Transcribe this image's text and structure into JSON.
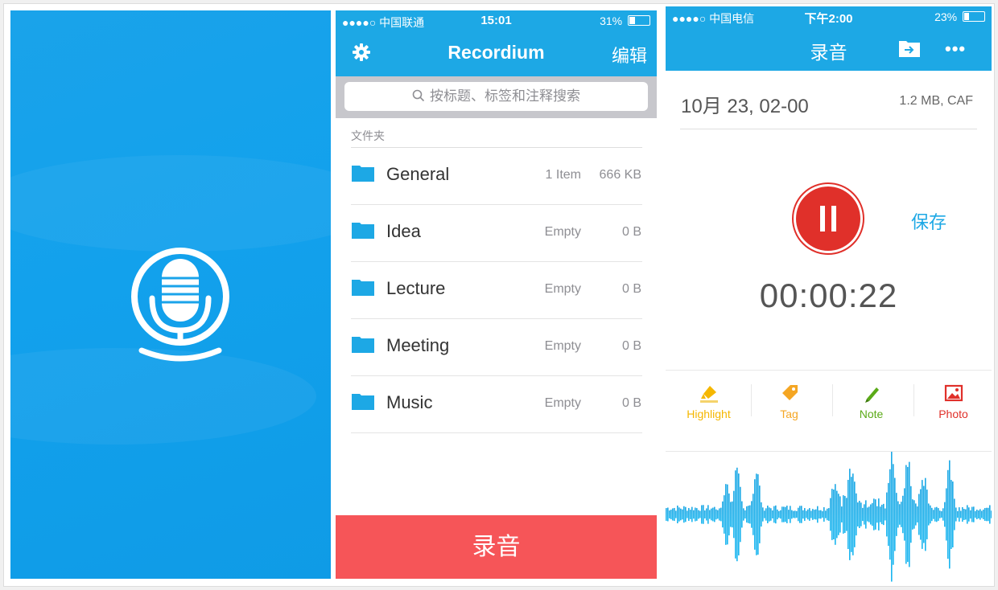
{
  "colors": {
    "brand_blue": "#1da8e5",
    "record_red": "#f65558",
    "highlight": "#f5b700",
    "tag": "#f5a623",
    "note": "#5aaa17",
    "photo": "#e0302a"
  },
  "splash": {
    "logo_icon": "microphone-icon"
  },
  "folders_screen": {
    "status": {
      "carrier": "●●●●○ 中国联通",
      "time": "15:01",
      "battery": "31%",
      "battery_level": 0.31
    },
    "title": "Recordium",
    "edit_label": "编辑",
    "search_placeholder": "按标题、标签和注释搜索",
    "section_label": "文件夹",
    "folders": [
      {
        "name": "General",
        "count": "1 Item",
        "size": "666 KB"
      },
      {
        "name": "Idea",
        "count": "Empty",
        "size": "0 B"
      },
      {
        "name": "Lecture",
        "count": "Empty",
        "size": "0 B"
      },
      {
        "name": "Meeting",
        "count": "Empty",
        "size": "0 B"
      },
      {
        "name": "Music",
        "count": "Empty",
        "size": "0 B"
      }
    ],
    "record_button": "录音"
  },
  "recording_screen": {
    "status": {
      "carrier": "●●●●○ 中国电信",
      "time": "下午2:00",
      "battery": "23%",
      "battery_level": 0.23
    },
    "title": "录音",
    "more_label": "•••",
    "recording_name": "10月 23, 02-00",
    "recording_meta": "1.2 MB, CAF",
    "save_label": "保存",
    "timer": "00:00:22",
    "tools": [
      {
        "label": "Highlight",
        "icon": "highlighter-icon"
      },
      {
        "label": "Tag",
        "icon": "tag-icon"
      },
      {
        "label": "Note",
        "icon": "pencil-icon"
      },
      {
        "label": "Photo",
        "icon": "photo-icon"
      }
    ]
  }
}
